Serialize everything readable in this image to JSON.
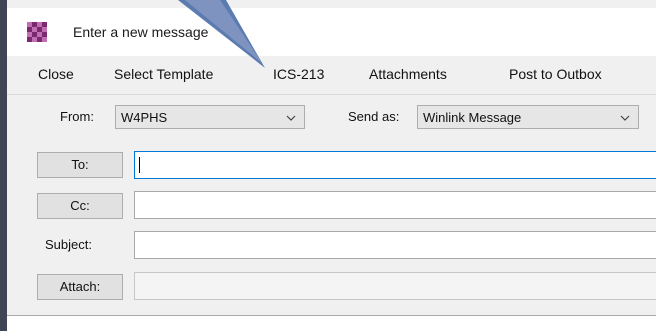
{
  "window": {
    "title": "Enter a new message",
    "app_icon": "winlink-checker-icon"
  },
  "menu": [
    {
      "label": "Close"
    },
    {
      "label": "Select Template"
    },
    {
      "label": "ICS-213"
    },
    {
      "label": "Attachments"
    },
    {
      "label": "Post to Outbox"
    }
  ],
  "form": {
    "from_label": "From:",
    "from_value": "W4PHS",
    "send_as_label": "Send as:",
    "send_as_value": "Winlink Message",
    "to_button": "To:",
    "to_value": "",
    "cc_button": "Cc:",
    "cc_value": "",
    "subject_label": "Subject:",
    "subject_value": "",
    "attach_button": "Attach:",
    "attach_value": ""
  },
  "colors": {
    "slide_background": "#3f4554",
    "pointer_arrow": "#6b7fb0",
    "focus_border": "#0078d7"
  }
}
